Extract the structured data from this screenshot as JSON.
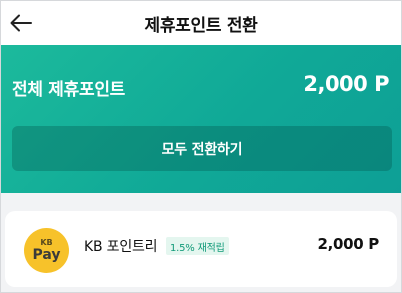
{
  "header": {
    "title": "제휴포인트 전환",
    "back_icon": "arrow-left-icon"
  },
  "summary": {
    "label": "전체 제휴포인트",
    "amount": "2,000 P",
    "convert_all_label": "모두 전환하기",
    "accent_color": "#12ad98"
  },
  "points_list": [
    {
      "logo_text_top": "KB",
      "logo_text_bottom": "Pay",
      "logo_color": "#f7c22a",
      "name": "KB 포인트리",
      "rate_badge": "1.5% 재적립",
      "amount": "2,000 P"
    }
  ]
}
